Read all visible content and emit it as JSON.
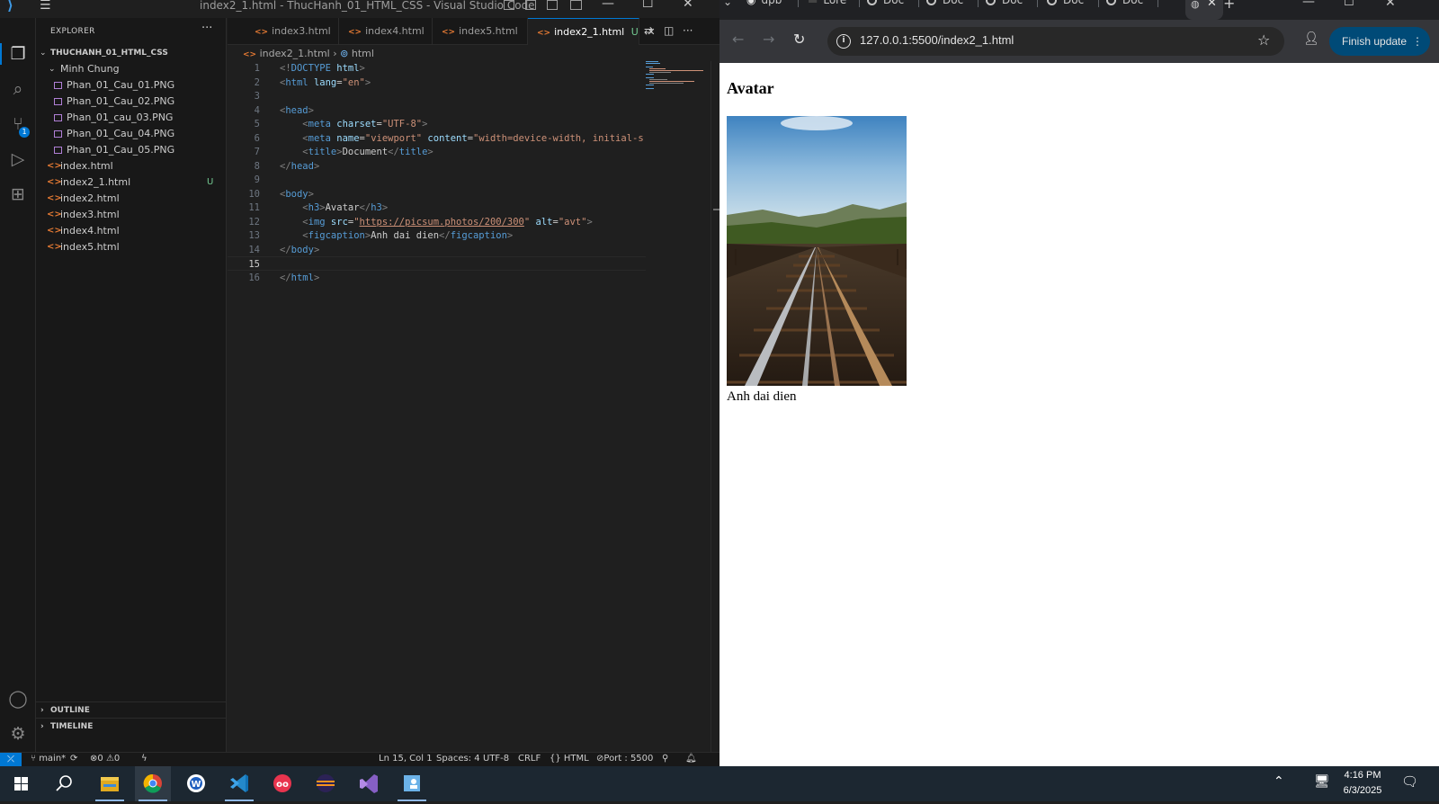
{
  "vscode": {
    "window_title": "index2_1.html - ThucHanh_01_HTML_CSS - Visual Studio Code",
    "explorer_title": "EXPLORER",
    "root_folder": "THUCHANH_01_HTML_CSS",
    "subfolder": "Minh Chung",
    "png_files": [
      "Phan_01_Cau_01.PNG",
      "Phan_01_Cau_02.PNG",
      "Phan_01_cau_03.PNG",
      "Phan_01_Cau_04.PNG",
      "Phan_01_Cau_05.PNG"
    ],
    "html_files": [
      "index.html",
      "index2_1.html",
      "index2.html",
      "index3.html",
      "index4.html",
      "index5.html"
    ],
    "untracked_badge": "U",
    "outline_label": "OUTLINE",
    "timeline_label": "TIMELINE",
    "tabs": [
      "index3.html",
      "index4.html",
      "index5.html",
      "index2_1.html"
    ],
    "active_tab_suffix": "U",
    "breadcrumb": [
      "index2_1.html",
      "html"
    ],
    "scm_count": "1",
    "current_line": 15,
    "code_lines": [
      [
        [
          "t-br",
          "<!"
        ],
        [
          "t-tag",
          "DOCTYPE"
        ],
        [
          "t-txt",
          " "
        ],
        [
          "t-attr",
          "html"
        ],
        [
          "t-br",
          ">"
        ]
      ],
      [
        [
          "t-br",
          "<"
        ],
        [
          "t-tag",
          "html"
        ],
        [
          "t-txt",
          " "
        ],
        [
          "t-attr",
          "lang"
        ],
        [
          "t-txt",
          "="
        ],
        [
          "t-str",
          "\"en\""
        ],
        [
          "t-br",
          ">"
        ]
      ],
      [],
      [
        [
          "t-br",
          "<"
        ],
        [
          "t-tag",
          "head"
        ],
        [
          "t-br",
          ">"
        ]
      ],
      [
        [
          "t-txt",
          "    "
        ],
        [
          "t-br",
          "<"
        ],
        [
          "t-tag",
          "meta"
        ],
        [
          "t-txt",
          " "
        ],
        [
          "t-attr",
          "charset"
        ],
        [
          "t-txt",
          "="
        ],
        [
          "t-str",
          "\"UTF-8\""
        ],
        [
          "t-br",
          ">"
        ]
      ],
      [
        [
          "t-txt",
          "    "
        ],
        [
          "t-br",
          "<"
        ],
        [
          "t-tag",
          "meta"
        ],
        [
          "t-txt",
          " "
        ],
        [
          "t-attr",
          "name"
        ],
        [
          "t-txt",
          "="
        ],
        [
          "t-str",
          "\"viewport\""
        ],
        [
          "t-txt",
          " "
        ],
        [
          "t-attr",
          "content"
        ],
        [
          "t-txt",
          "="
        ],
        [
          "t-str",
          "\"width=device-width, initial-s"
        ]
      ],
      [
        [
          "t-txt",
          "    "
        ],
        [
          "t-br",
          "<"
        ],
        [
          "t-tag",
          "title"
        ],
        [
          "t-br",
          ">"
        ],
        [
          "t-txt",
          "Document"
        ],
        [
          "t-br",
          "</"
        ],
        [
          "t-tag",
          "title"
        ],
        [
          "t-br",
          ">"
        ]
      ],
      [
        [
          "t-br",
          "</"
        ],
        [
          "t-tag",
          "head"
        ],
        [
          "t-br",
          ">"
        ]
      ],
      [],
      [
        [
          "t-br",
          "<"
        ],
        [
          "t-tag",
          "body"
        ],
        [
          "t-br",
          ">"
        ]
      ],
      [
        [
          "t-txt",
          "    "
        ],
        [
          "t-br",
          "<"
        ],
        [
          "t-tag",
          "h3"
        ],
        [
          "t-br",
          ">"
        ],
        [
          "t-txt",
          "Avatar"
        ],
        [
          "t-br",
          "</"
        ],
        [
          "t-tag",
          "h3"
        ],
        [
          "t-br",
          ">"
        ]
      ],
      [
        [
          "t-txt",
          "    "
        ],
        [
          "t-br",
          "<"
        ],
        [
          "t-tag",
          "img"
        ],
        [
          "t-txt",
          " "
        ],
        [
          "t-attr",
          "src"
        ],
        [
          "t-txt",
          "="
        ],
        [
          "t-str",
          "\""
        ],
        [
          "t-link",
          "https://picsum.photos/200/300"
        ],
        [
          "t-str",
          "\""
        ],
        [
          "t-txt",
          " "
        ],
        [
          "t-attr",
          "alt"
        ],
        [
          "t-txt",
          "="
        ],
        [
          "t-str",
          "\"avt\""
        ],
        [
          "t-br",
          ">"
        ]
      ],
      [
        [
          "t-txt",
          "    "
        ],
        [
          "t-br",
          "<"
        ],
        [
          "t-tag",
          "figcaption"
        ],
        [
          "t-br",
          ">"
        ],
        [
          "t-txt",
          "Anh dai dien"
        ],
        [
          "t-br",
          "</"
        ],
        [
          "t-tag",
          "figcaption"
        ],
        [
          "t-br",
          ">"
        ]
      ],
      [
        [
          "t-br",
          "</"
        ],
        [
          "t-tag",
          "body"
        ],
        [
          "t-br",
          ">"
        ]
      ],
      [],
      [
        [
          "t-br",
          "</"
        ],
        [
          "t-tag",
          "html"
        ],
        [
          "t-br",
          ">"
        ]
      ]
    ],
    "status": {
      "branch": "main*",
      "errors": "0",
      "warnings": "0",
      "position": "Ln 15, Col 1",
      "spaces": "Spaces: 4",
      "encoding": "UTF-8",
      "eol": "CRLF",
      "language": "HTML",
      "port": "Port : 5500"
    }
  },
  "chrome": {
    "tabs": [
      "dpb",
      "Lore",
      "Doc",
      "Doc",
      "Doc",
      "Doc",
      "Doc"
    ],
    "url": "127.0.0.1:5500/index2_1.html",
    "finish_update": "Finish update",
    "page": {
      "heading": "Avatar",
      "caption": "Anh dai dien"
    }
  },
  "taskbar": {
    "time": "4:16 PM",
    "date": "6/3/2025"
  },
  "colors": {
    "vscode_bg": "#1f1f1f",
    "accent": "#0078d4",
    "chrome_update": "#004a77"
  }
}
